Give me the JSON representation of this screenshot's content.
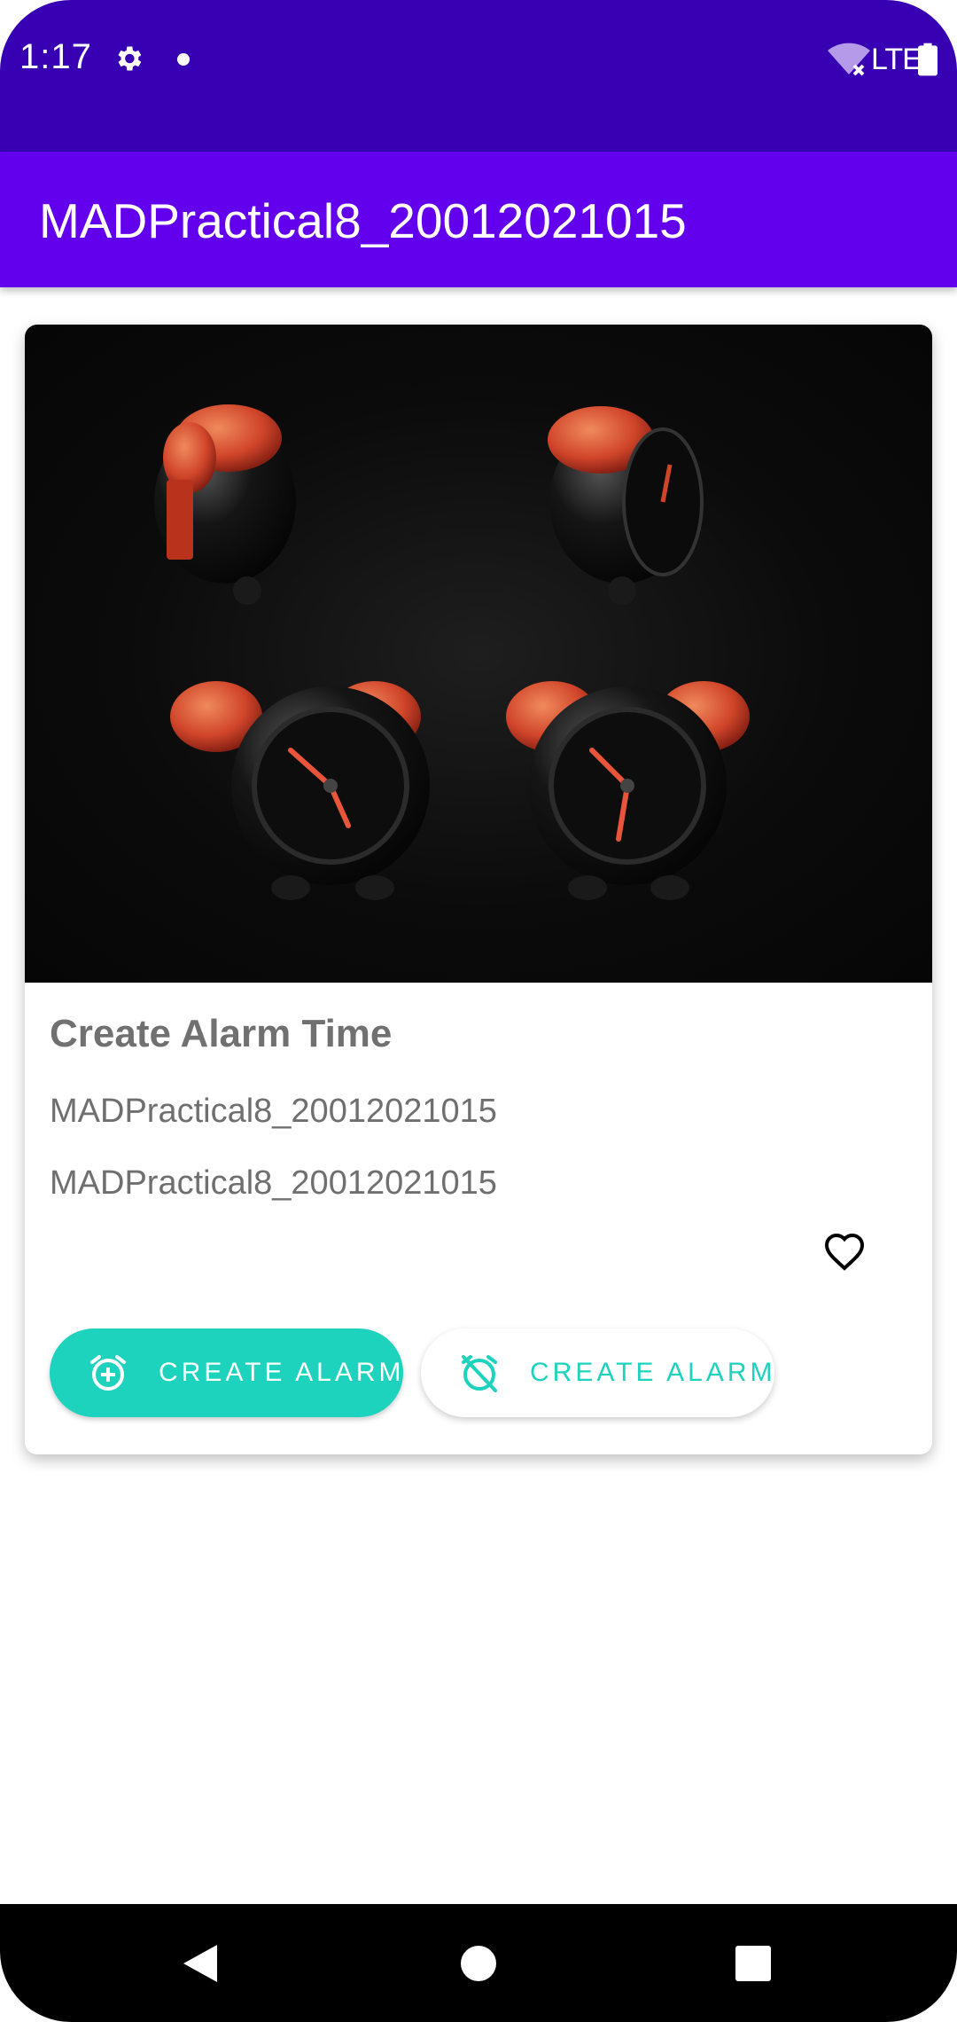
{
  "status_bar": {
    "time": "1:17",
    "network": "LTE",
    "icons": [
      "gear-icon",
      "notification-dot-icon",
      "wifi-off-icon",
      "battery-icon"
    ]
  },
  "app_bar": {
    "title": "MADPractical8_20012021015"
  },
  "card": {
    "media_icon": "alarm-clocks-image",
    "title": "Create Alarm Time",
    "subtitle": "MADPractical8_20012021015",
    "body": "MADPractical8_20012021015",
    "favorite_icon": "heart-outline-icon",
    "primary_button": {
      "label": "CREATE ALARM",
      "icon": "alarm-add-icon"
    },
    "secondary_button": {
      "label": "CREATE ALARM",
      "icon": "alarm-off-icon"
    }
  },
  "nav_bar": {
    "icons": [
      "back-icon",
      "home-icon",
      "recents-icon"
    ]
  },
  "colors": {
    "status_bar": "#3700b3",
    "app_bar": "#6200ee",
    "accent_teal": "#1dd3bd",
    "nav_bar": "#000000"
  }
}
